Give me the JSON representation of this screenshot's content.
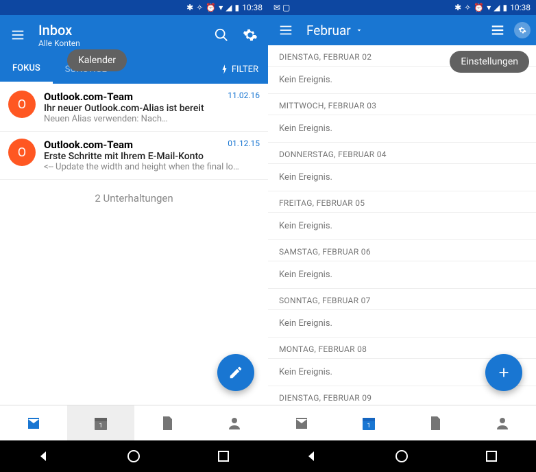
{
  "statusbar": {
    "time": "10:38"
  },
  "left": {
    "appbar": {
      "title": "Inbox",
      "subtitle": "Alle Konten"
    },
    "tabs": {
      "focus": "FOKUS",
      "other": "SONSTIGE",
      "filter": "FILTER"
    },
    "tooltip": "Kalender",
    "emails": [
      {
        "avatar": "O",
        "sender": "Outlook.com-Team",
        "date": "11.02.16",
        "subject": "Ihr neuer Outlook.com-Alias ist bereit",
        "preview": "Neuen Alias verwenden:                          Nach…"
      },
      {
        "avatar": "O",
        "sender": "Outlook.com-Team",
        "date": "01.12.15",
        "subject": "Erste Schritte mit Ihrem E-Mail-Konto",
        "preview": "<-- Update the width and height when the final lo…"
      }
    ],
    "conversations": "2 Unterhaltungen"
  },
  "right": {
    "appbar": {
      "title": "Februar"
    },
    "tooltip": "Einstellungen",
    "no_event": "Kein Ereignis.",
    "days": [
      "DIENSTAG, FEBRUAR 02",
      "MITTWOCH, FEBRUAR 03",
      "DONNERSTAG, FEBRUAR 04",
      "FREITAG, FEBRUAR 05",
      "SAMSTAG, FEBRUAR 06",
      "SONNTAG, FEBRUAR 07",
      "MONTAG, FEBRUAR 08",
      "DIENSTAG, FEBRUAR 09"
    ]
  }
}
